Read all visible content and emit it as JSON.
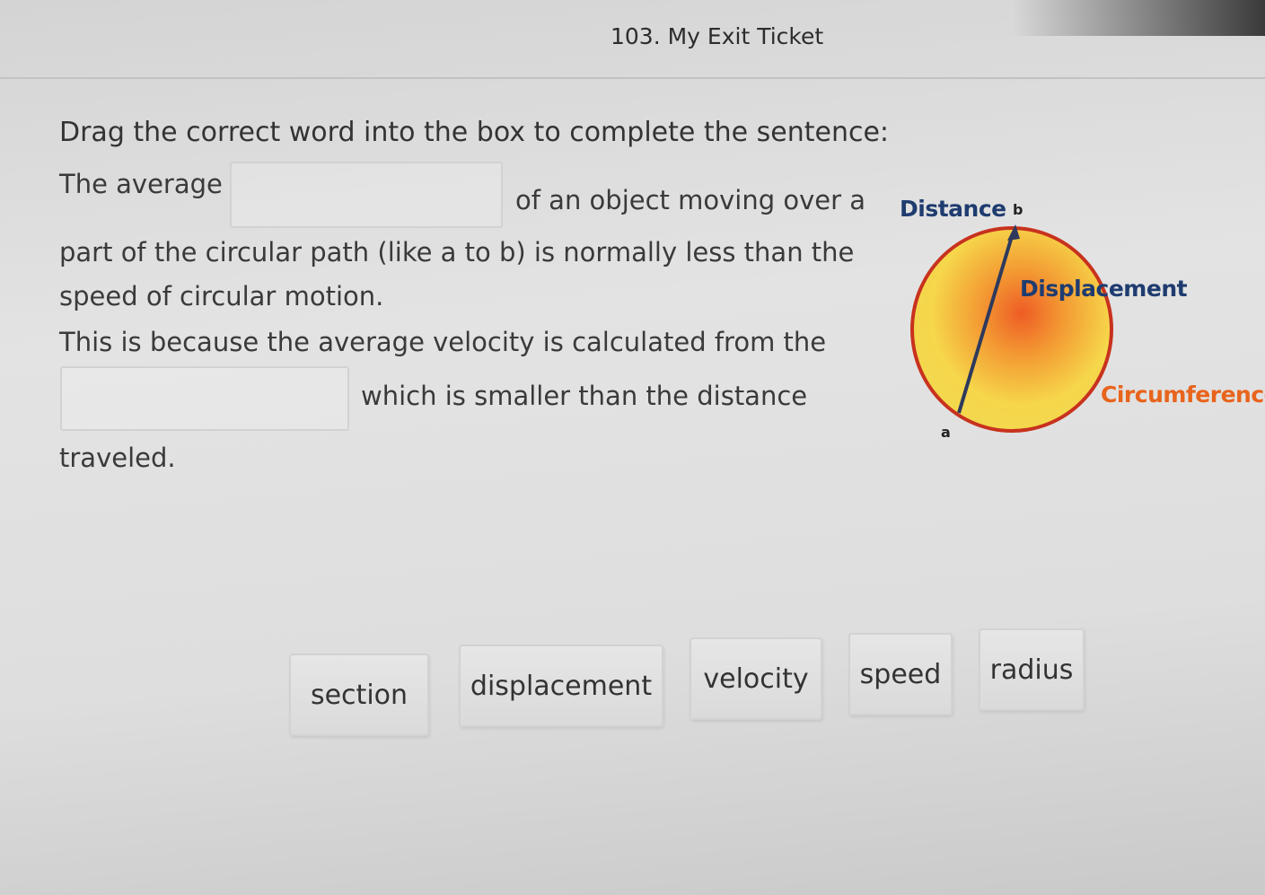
{
  "header": {
    "title": "103. My Exit Ticket"
  },
  "question": {
    "prompt": "Drag the correct word into the box to complete the sentence:",
    "line1_start": "The average",
    "line1_end": "of an object moving over a",
    "line2": "part of the circular path (like a to b) is normally less than the",
    "line3": "speed of circular motion.",
    "line4": "This is because the average velocity is calculated from the",
    "line5_end": "which is smaller than the distance",
    "line6": "traveled."
  },
  "diagram": {
    "distance_label": "Distance",
    "displacement_label": "Displacement",
    "circumference_label": "Circumference",
    "point_a": "a",
    "point_b": "b",
    "colors": {
      "distance": "#1f3c70",
      "displacement": "#1f3c70",
      "circumference": "#e8641c",
      "circle_outline": "#c8321e",
      "circle_fill": "#f5d54a"
    }
  },
  "word_bank": [
    "section",
    "displacement",
    "velocity",
    "speed",
    "radius"
  ]
}
